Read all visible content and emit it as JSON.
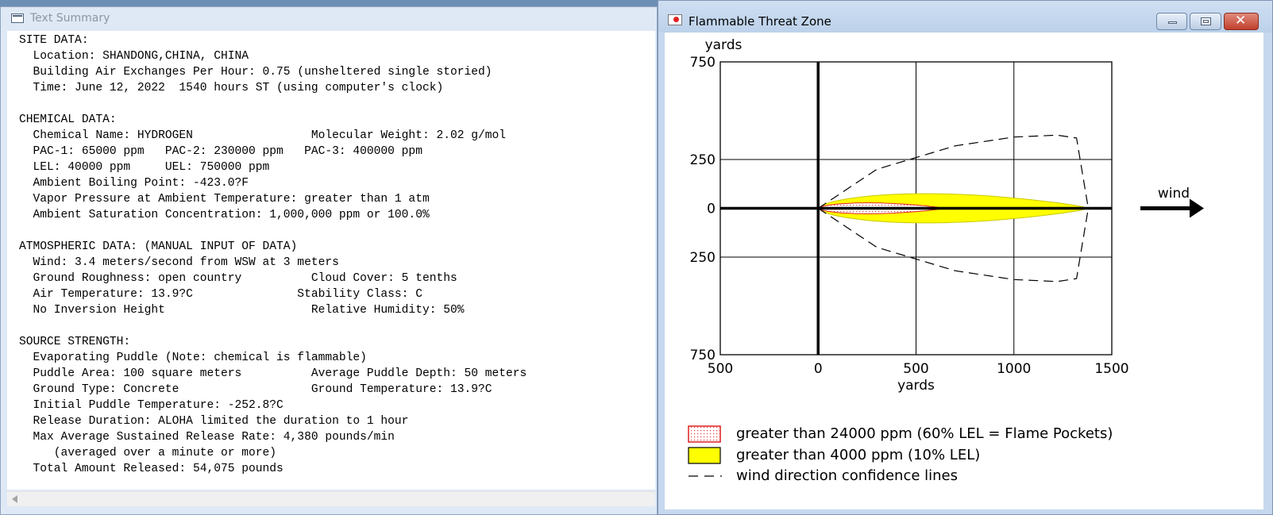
{
  "text_summary": {
    "title": "Text Summary",
    "lines": [
      "SITE DATA:",
      "  Location: SHANDONG,CHINA, CHINA",
      "  Building Air Exchanges Per Hour: 0.75 (unsheltered single storied)",
      "  Time: June 12, 2022  1540 hours ST (using computer's clock)",
      "",
      "CHEMICAL DATA:",
      "  Chemical Name: HYDROGEN                 Molecular Weight: 2.02 g/mol",
      "  PAC-1: 65000 ppm   PAC-2: 230000 ppm   PAC-3: 400000 ppm",
      "  LEL: 40000 ppm     UEL: 750000 ppm",
      "  Ambient Boiling Point: -423.0?F",
      "  Vapor Pressure at Ambient Temperature: greater than 1 atm",
      "  Ambient Saturation Concentration: 1,000,000 ppm or 100.0%",
      "",
      "ATMOSPHERIC DATA: (MANUAL INPUT OF DATA)",
      "  Wind: 3.4 meters/second from WSW at 3 meters",
      "  Ground Roughness: open country          Cloud Cover: 5 tenths",
      "  Air Temperature: 13.9?C               Stability Class: C",
      "  No Inversion Height                     Relative Humidity: 50%",
      "",
      "SOURCE STRENGTH:",
      "  Evaporating Puddle (Note: chemical is flammable)",
      "  Puddle Area: 100 square meters          Average Puddle Depth: 50 meters",
      "  Ground Type: Concrete                   Ground Temperature: 13.9?C",
      "  Initial Puddle Temperature: -252.8?C",
      "  Release Duration: ALOHA limited the duration to 1 hour",
      "  Max Average Sustained Release Rate: 4,380 pounds/min",
      "     (averaged over a minute or more)",
      "  Total Amount Released: 54,075 pounds"
    ]
  },
  "threat_window": {
    "title": "Flammable Threat Zone",
    "close_glyph": "✕"
  },
  "chart_data": {
    "type": "area",
    "x_unit_label": "yards",
    "y_unit_label": "yards",
    "xlim": [
      -500,
      1500
    ],
    "ylim": [
      -750,
      750
    ],
    "x_ticks": [
      -500,
      0,
      500,
      1000,
      1500
    ],
    "x_tick_labels": [
      "500",
      "0",
      "500",
      "1000",
      "1500"
    ],
    "y_ticks": [
      750,
      250,
      0,
      -250,
      -750
    ],
    "y_tick_labels": [
      "750",
      "250",
      "0",
      "250",
      "750"
    ],
    "grid": true,
    "wind_label": "wind",
    "zones": [
      {
        "name": "greater than 24000 ppm (60% LEL = Flame Pockets)",
        "color": "#ff0000",
        "fill": "dotted-red",
        "x_start": 0,
        "x_end": 640,
        "max_half_width": 28
      },
      {
        "name": "greater than 4000 ppm (10% LEL)",
        "color": "#ffff00",
        "fill": "yellow",
        "x_start": 0,
        "x_end": 1380,
        "max_half_width": 75
      }
    ],
    "confidence_lines": {
      "name": "wind direction confidence lines",
      "upper": [
        [
          0,
          0
        ],
        [
          300,
          200
        ],
        [
          700,
          320
        ],
        [
          1000,
          365
        ],
        [
          1220,
          375
        ],
        [
          1320,
          360
        ],
        [
          1380,
          0
        ]
      ],
      "lower": [
        [
          0,
          0
        ],
        [
          300,
          -200
        ],
        [
          700,
          -320
        ],
        [
          1000,
          -365
        ],
        [
          1220,
          -375
        ],
        [
          1320,
          -360
        ],
        [
          1380,
          0
        ]
      ]
    },
    "legend": [
      {
        "label": "greater than 24000 ppm (60% LEL = Flame Pockets)",
        "swatch": "dotted-red"
      },
      {
        "label": "greater than 4000 ppm (10% LEL)",
        "swatch": "yellow"
      },
      {
        "label": "wind direction confidence lines",
        "swatch": "dashed-line"
      }
    ],
    "legend_position": "bottom"
  }
}
